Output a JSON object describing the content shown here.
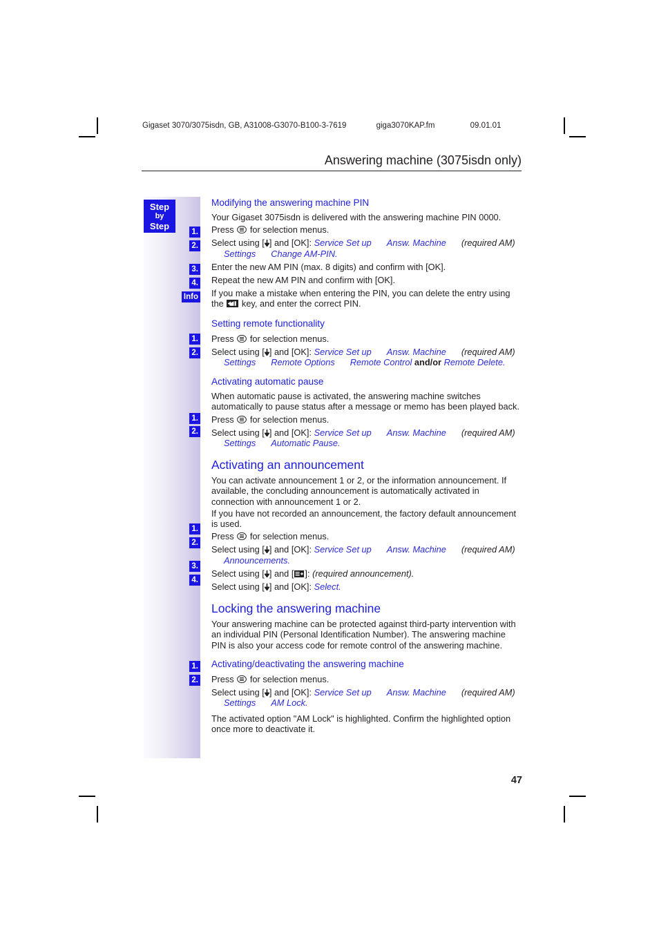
{
  "print_line": {
    "document": "Gigaset 3070/3075isdn, GB, A31008-G3070-B100-3-7619",
    "file": "giga3070KAP.fm",
    "date": "09.01.01"
  },
  "chapter_header": "Answering machine (3075isdn only)",
  "sidebar": {
    "step_box": {
      "line1": "Step",
      "line2": "by",
      "line3": "Step"
    },
    "badges": [
      "1.",
      "2.",
      "3.",
      "4.",
      "Info"
    ]
  },
  "page_number": "47",
  "icons": {
    "menu_key": "menu-key-icon",
    "back_key": "back-delete-key-icon",
    "display_key": "display-key-icon",
    "down_key": "down-arrow-key-icon"
  },
  "sections": [
    {
      "id": "modifying-pin",
      "level": "sub",
      "title": "Modifying the answering machine PIN",
      "intro": "Your Gigaset 3075isdn is delivered with the answering machine PIN 0000.",
      "steps": [
        {
          "badge": "1.",
          "text_before": "Press ",
          "icon": "menu",
          "text_after": " for selection menus."
        },
        {
          "badge": "2.",
          "lead": "Select using [",
          "lead2": "] and [OK]: ",
          "path": [
            "Service Set up",
            "Answ. Machine",
            "(required AM)",
            "Settings",
            "Change AM-PIN."
          ],
          "note_index": 2
        },
        {
          "badge": "3.",
          "plain": "Enter the new AM PIN (max. 8 digits) and confirm with [OK]."
        },
        {
          "badge": "4.",
          "plain": "Repeat the new AM PIN and confirm with [OK]."
        },
        {
          "badge": "Info",
          "info_before": "If you make a mistake when entering the PIN, you can delete the entry using the ",
          "icon": "back",
          "info_after": " key, and enter the correct PIN."
        }
      ]
    },
    {
      "id": "remote-functionality",
      "level": "sub",
      "title": "Setting remote functionality",
      "steps": [
        {
          "badge": "1.",
          "text_before": "Press ",
          "icon": "menu",
          "text_after": " for selection menus."
        },
        {
          "badge": "2.",
          "path": [
            "Service Set up",
            "Answ. Machine",
            "(required AM)",
            "Settings",
            "Remote Options",
            "Remote Control",
            "and/or",
            "Remote Delete."
          ]
        }
      ]
    },
    {
      "id": "automatic-pause",
      "level": "sub",
      "title": "Activating automatic pause",
      "intro": "When automatic pause is activated, the answering machine switches automatically to pause status after a message or memo has been played back.",
      "steps": [
        {
          "badge": "1.",
          "text_before": "Press ",
          "icon": "menu",
          "text_after": " for selection menus."
        },
        {
          "badge": "2.",
          "path": [
            "Service Set up",
            "Answ. Machine",
            "(required AM)",
            "Settings",
            "Automatic Pause."
          ]
        }
      ]
    },
    {
      "id": "activating-announcement",
      "level": "main",
      "title": "Activating an announcement",
      "intro": "You can activate announcement 1 or 2, or the information announcement. If available, the concluding announcement is automatically activated in connection with announcement 1 or 2.",
      "intro2": "If you have not recorded an announcement, the factory default announcement is used.",
      "steps": [
        {
          "badge": "1.",
          "text_before": "Press ",
          "icon": "menu",
          "text_after": " for selection menus."
        },
        {
          "badge": "2.",
          "path": [
            "Service Set up",
            "Answ. Machine",
            "(required AM)",
            "Announcements."
          ]
        },
        {
          "badge": "3.",
          "display_step": true,
          "display_note": "(required announcement)."
        },
        {
          "badge": "4.",
          "path": [
            "Select."
          ]
        }
      ]
    },
    {
      "id": "locking",
      "level": "main",
      "title": "Locking the answering machine",
      "intro": "Your answering machine can be protected against third-party intervention with an individual PIN (Personal Identification Number). The answering machine PIN is also your access code for remote control of the answering machine.",
      "sub": {
        "title": "Activating/deactivating the answering machine",
        "steps": [
          {
            "badge": "1.",
            "text_before": "Press ",
            "icon": "menu",
            "text_after": " for selection menus."
          },
          {
            "badge": "2.",
            "path": [
              "Service Set up",
              "Answ. Machine",
              "(required AM)",
              "Settings",
              "AM Lock."
            ]
          }
        ],
        "outro": "The activated option \"AM Lock\" is highlighted. Confirm the highlighted option once more to deactivate it."
      }
    }
  ],
  "common": {
    "select_using": "Select using [",
    "and_ok": "] and [OK]: ",
    "and_display": "] and [",
    "display_close": "]: ",
    "press": "Press ",
    "for_menus": " for selection menus."
  }
}
